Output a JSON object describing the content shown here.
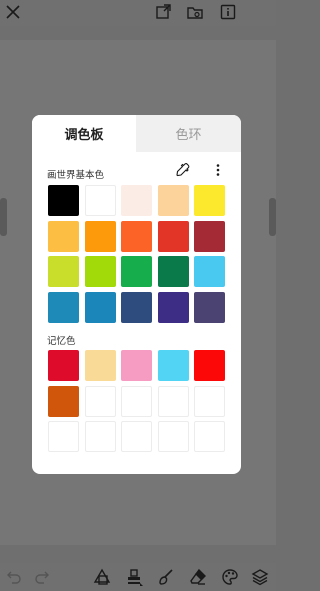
{
  "dialog": {
    "tabs": [
      {
        "label": "调色板",
        "active": true
      },
      {
        "label": "色环",
        "active": false
      }
    ],
    "basic_section_label": "画世界基本色",
    "memory_section_label": "记忆色",
    "basic_colors": [
      [
        "#000000",
        "#ffffff",
        "#fcece6",
        "#fcd39b",
        "#fce82d"
      ],
      [
        "#fcbf44",
        "#fc9a0b",
        "#fc6326",
        "#e23527",
        "#a42b36"
      ],
      [
        "#c9de2b",
        "#a1d909",
        "#16ad4c",
        "#0a7a4b",
        "#49c9f0"
      ],
      [
        "#1e8ab8",
        "#1b86ba",
        "#2e4c7d",
        "#3d2d85",
        "#4b4371"
      ]
    ],
    "memory_colors": [
      [
        "#de0b2a",
        "#f9da97",
        "#f69cc2",
        "#52d5f4",
        "#fc0808"
      ],
      [
        "#cf560b",
        "",
        "",
        "",
        ""
      ],
      [
        "",
        "",
        "",
        "",
        ""
      ]
    ]
  },
  "icons": {
    "top": [
      "close-icon",
      "layer-import-icon",
      "folder-icon",
      "info-icon"
    ],
    "bottom": [
      "undo-icon",
      "redo-icon",
      "shape-tool-icon",
      "stamp-tool-icon",
      "brush-tool-icon",
      "eraser-tool-icon",
      "palette-tool-icon",
      "layers-icon"
    ],
    "dialog": [
      "eyedropper-icon",
      "more-vert-icon"
    ]
  }
}
